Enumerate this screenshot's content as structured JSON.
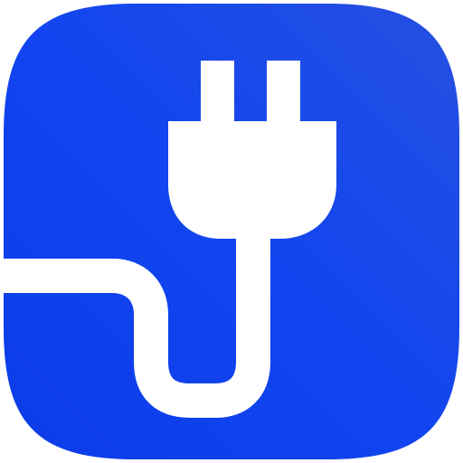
{
  "icon": {
    "name": "electric-plug-app-icon",
    "glyph": "plug-icon",
    "colors": {
      "background_top_right": "#2650E0",
      "background_mid": "#1245F0",
      "background_bottom_left": "#0B3CE8",
      "glyph": "#FFFFFF"
    }
  }
}
